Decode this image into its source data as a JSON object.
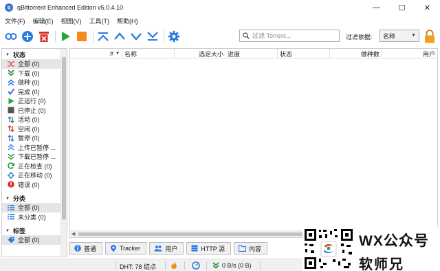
{
  "window": {
    "title": "qBittorrent Enhanced Edition v5.0.4.10",
    "controls": [
      "—",
      "☐",
      "✕"
    ]
  },
  "menu": {
    "items": [
      "文件(F)",
      "编辑(E)",
      "视图(V)",
      "工具(T)",
      "帮助(H)"
    ]
  },
  "toolbar": {
    "buttons": [
      "add-link",
      "add-torrent",
      "remove-torrent",
      "resume",
      "pause",
      "move-top",
      "move-up",
      "move-down",
      "move-bottom",
      "options"
    ],
    "search_placeholder": "过滤 Torrent...",
    "filter_label": "过滤依据:",
    "filter_value": "名称",
    "colors": {
      "blue": "#2a7ae2",
      "red": "#d9322b",
      "green": "#21a83a",
      "orange": "#f28c1c",
      "lock": "#f0a020"
    }
  },
  "sidebar": {
    "status_header": "状态",
    "status_items": [
      {
        "label": "全部 (0)",
        "icon": "shuffle-icon",
        "color": "#e0473a"
      },
      {
        "label": "下载 (0)",
        "icon": "double-down-icon",
        "color": "#1f8a2e"
      },
      {
        "label": "做种 (0)",
        "icon": "double-up-icon",
        "color": "#2a7ae2"
      },
      {
        "label": "完成 (0)",
        "icon": "check-icon",
        "color": "#3d5bd9"
      },
      {
        "label": "正运行 (0)",
        "icon": "play-icon",
        "color": "#21a83a"
      },
      {
        "label": "已停止 (0)",
        "icon": "stop-icon",
        "color": "#555555"
      },
      {
        "label": "活动 (0)",
        "icon": "updown-active-icon",
        "color": "#1f8a2e"
      },
      {
        "label": "空闲 (0)",
        "icon": "updown-idle-icon",
        "color": "#d9322b"
      },
      {
        "label": "暂停 (0)",
        "icon": "updown-paused-icon",
        "color": "#2a7ae2"
      },
      {
        "label": "上传已暂停 ...",
        "icon": "up-paused-icon",
        "color": "#2a7ae2"
      },
      {
        "label": "下载已暂停 ...",
        "icon": "down-paused-icon",
        "color": "#1f8a2e"
      },
      {
        "label": "正在检查 (0)",
        "icon": "refresh-icon",
        "color": "#1f8a2e"
      },
      {
        "label": "正在移动 (0)",
        "icon": "move-icon",
        "color": "#2a7ae2"
      },
      {
        "label": "错误 (0)",
        "icon": "error-icon",
        "color": "#d9322b"
      }
    ],
    "category_header": "分类",
    "category_items": [
      {
        "label": "全部 (0)",
        "icon": "list-icon"
      },
      {
        "label": "未分类 (0)",
        "icon": "list-icon"
      }
    ],
    "tag_header": "标签",
    "tag_items": [
      {
        "label": "全部 (0)",
        "icon": "tag-icon"
      }
    ]
  },
  "table": {
    "columns": [
      "#",
      "名称",
      "选定大小",
      "进度",
      "状态",
      "做种数",
      "用户"
    ]
  },
  "bottom_tabs": [
    "普通",
    "Tracker",
    "用户",
    "HTTP 源",
    "内容"
  ],
  "statusbar": {
    "dht": "DHT: 78 结点",
    "down_speed": "0 B/s (0 B)"
  },
  "watermark": {
    "line1": "WX公众号",
    "line2": "软师兄"
  }
}
